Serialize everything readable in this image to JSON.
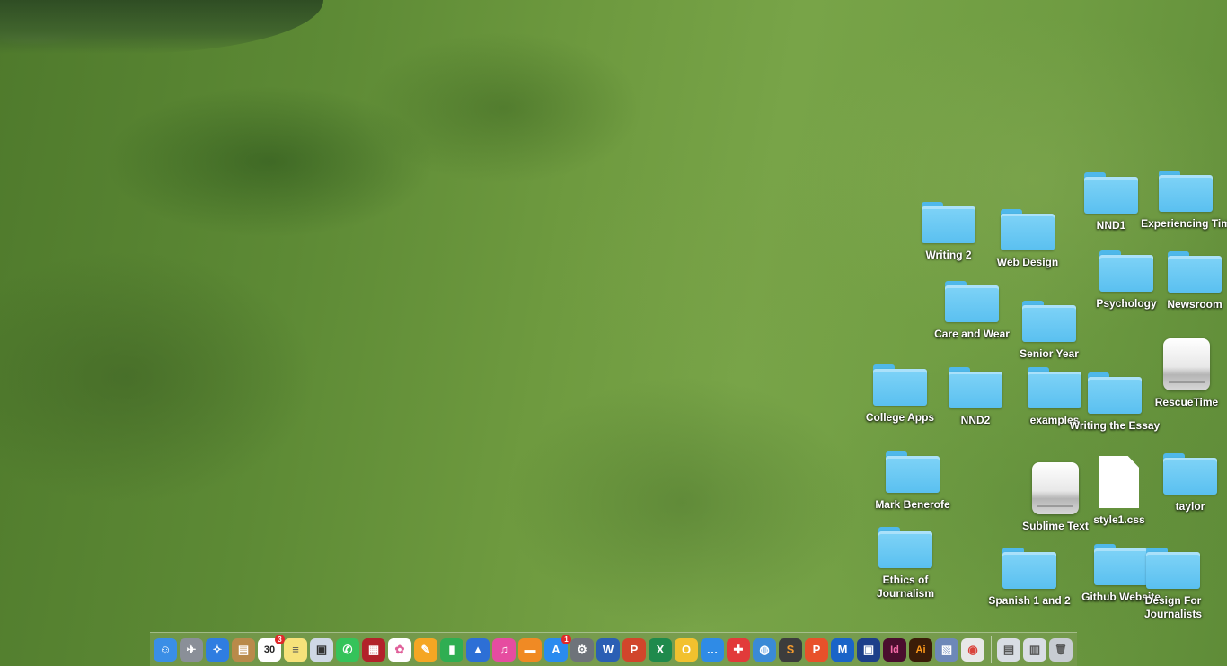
{
  "desktop_icons": [
    {
      "name": "NND1",
      "type": "folder"
    },
    {
      "name": "Experiencing Tim",
      "type": "folder"
    },
    {
      "name": "Writing 2",
      "type": "folder"
    },
    {
      "name": "Web Design",
      "type": "folder"
    },
    {
      "name": "Psychology",
      "type": "folder"
    },
    {
      "name": "Newsroom",
      "type": "folder"
    },
    {
      "name": "Care and Wear",
      "type": "folder"
    },
    {
      "name": "Senior Year",
      "type": "folder"
    },
    {
      "name": "RescueTime",
      "type": "drive"
    },
    {
      "name": "College Apps",
      "type": "folder"
    },
    {
      "name": "NND2",
      "type": "folder"
    },
    {
      "name": "examples",
      "type": "folder"
    },
    {
      "name": "Writing the Essay",
      "type": "folder"
    },
    {
      "name": "Mark Benerofe",
      "type": "folder"
    },
    {
      "name": "Sublime Text",
      "type": "drive"
    },
    {
      "name": "style1.css",
      "type": "document"
    },
    {
      "name": "taylor",
      "type": "folder"
    },
    {
      "name": "Ethics of Journalism",
      "type": "folder"
    },
    {
      "name": "Spanish 1 and 2",
      "type": "folder"
    },
    {
      "name": "Github Website",
      "type": "folder"
    },
    {
      "name": "Design For Journalists",
      "type": "folder"
    }
  ],
  "dock": {
    "items": [
      {
        "name": "finder-icon",
        "glyph": "☺",
        "bg": "#3a8ee6"
      },
      {
        "name": "launchpad-icon",
        "glyph": "✈",
        "bg": "#8a8f98"
      },
      {
        "name": "safari-icon",
        "glyph": "✧",
        "bg": "#2f7de1"
      },
      {
        "name": "notefile-icon",
        "glyph": "▤",
        "bg": "#b98a4a"
      },
      {
        "name": "calendar-icon",
        "glyph": "30",
        "bg": "#ffffff",
        "fg": "#222222",
        "badge": "3"
      },
      {
        "name": "notes-icon",
        "glyph": "≡",
        "bg": "#f7e27a",
        "fg": "#555555"
      },
      {
        "name": "preview-icon",
        "glyph": "▣",
        "bg": "#cfd8e6",
        "fg": "#333333"
      },
      {
        "name": "messages-icon",
        "glyph": "✆",
        "bg": "#35c35a"
      },
      {
        "name": "photo-booth-icon",
        "glyph": "▦",
        "bg": "#b2222a"
      },
      {
        "name": "photos-icon",
        "glyph": "✿",
        "bg": "#ffffff",
        "fg": "#e0609a"
      },
      {
        "name": "pages-icon",
        "glyph": "✎",
        "bg": "#f5a623"
      },
      {
        "name": "numbers-icon",
        "glyph": "▮",
        "bg": "#2fae52"
      },
      {
        "name": "keynote-icon",
        "glyph": "▲",
        "bg": "#2d6fd6"
      },
      {
        "name": "itunes-icon",
        "glyph": "♫",
        "bg": "#e64ca0"
      },
      {
        "name": "ibooks-icon",
        "glyph": "▬",
        "bg": "#f08a24"
      },
      {
        "name": "app-store-icon",
        "glyph": "A",
        "bg": "#2a8bef",
        "badge": "1"
      },
      {
        "name": "system-preferences-icon",
        "glyph": "⚙",
        "bg": "#6e737a"
      },
      {
        "name": "word-icon",
        "glyph": "W",
        "bg": "#2b5fb4"
      },
      {
        "name": "powerpoint-icon",
        "glyph": "P",
        "bg": "#d1452b"
      },
      {
        "name": "excel-icon",
        "glyph": "X",
        "bg": "#1f8a4c"
      },
      {
        "name": "outlook-icon",
        "glyph": "O",
        "bg": "#f2c12e"
      },
      {
        "name": "messenger-icon",
        "glyph": "…",
        "bg": "#2f8be6"
      },
      {
        "name": "vectorize-icon",
        "glyph": "✚",
        "bg": "#e23a3a"
      },
      {
        "name": "globe-icon",
        "glyph": "◍",
        "bg": "#3a8ad6"
      },
      {
        "name": "sublime-text-icon",
        "glyph": "S",
        "bg": "#3c3c3c",
        "fg": "#f29a2e"
      },
      {
        "name": "pinterest-icon",
        "glyph": "P",
        "bg": "#e8512a"
      },
      {
        "name": "malwarebytes-icon",
        "glyph": "M",
        "bg": "#1a64c8"
      },
      {
        "name": "screen-capture-icon",
        "glyph": "▣",
        "bg": "#1d3f8a"
      },
      {
        "name": "indesign-icon",
        "glyph": "Id",
        "bg": "#4a0e2e",
        "fg": "#f36ba8"
      },
      {
        "name": "illustrator-icon",
        "glyph": "Ai",
        "bg": "#3a1c08",
        "fg": "#ff9a1a"
      },
      {
        "name": "photos-folder-icon",
        "glyph": "▧",
        "bg": "#6d88b8"
      },
      {
        "name": "chrome-icon",
        "glyph": "◉",
        "bg": "#e8e8e8",
        "fg": "#d9423a"
      }
    ],
    "right_items": [
      {
        "name": "downloads-stack-icon",
        "glyph": "▤",
        "bg": "#d9dde4",
        "fg": "#555555"
      },
      {
        "name": "documents-stack-icon",
        "glyph": "▥",
        "bg": "#d9dde4",
        "fg": "#555555"
      },
      {
        "name": "trash-icon",
        "glyph": "🗑",
        "bg": "#c8ccd2",
        "fg": "#555555"
      }
    ]
  }
}
